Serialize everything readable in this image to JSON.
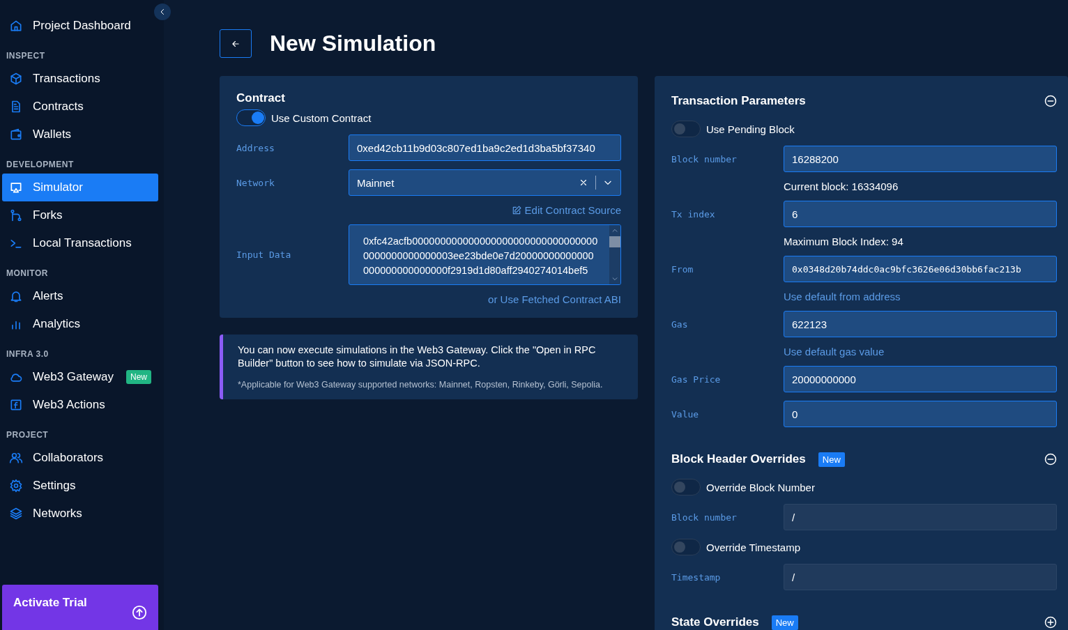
{
  "sidebar": {
    "top_item": {
      "label": "Project Dashboard",
      "selected": false
    },
    "sections": [
      {
        "title": "INSPECT",
        "items": [
          {
            "label": "Transactions",
            "selected": false
          },
          {
            "label": "Contracts",
            "selected": false
          },
          {
            "label": "Wallets",
            "selected": false
          }
        ]
      },
      {
        "title": "DEVELOPMENT",
        "items": [
          {
            "label": "Simulator",
            "selected": true
          },
          {
            "label": "Forks",
            "selected": false
          },
          {
            "label": "Local Transactions",
            "selected": false
          }
        ]
      },
      {
        "title": "MONITOR",
        "items": [
          {
            "label": "Alerts",
            "selected": false
          },
          {
            "label": "Analytics",
            "selected": false
          }
        ]
      },
      {
        "title": "INFRA 3.0",
        "items": [
          {
            "label": "Web3 Gateway",
            "selected": false,
            "badge": "New"
          },
          {
            "label": "Web3 Actions",
            "selected": false
          }
        ]
      },
      {
        "title": "PROJECT",
        "items": [
          {
            "label": "Collaborators",
            "selected": false
          },
          {
            "label": "Settings",
            "selected": false
          },
          {
            "label": "Networks",
            "selected": false
          }
        ]
      }
    ],
    "trial": {
      "title": "Activate Trial"
    }
  },
  "page_title": "New Simulation",
  "contract": {
    "title": "Contract",
    "toggle": {
      "label": "Use Custom Contract",
      "on": true
    },
    "rows": [
      {
        "kind": "input",
        "label": "Address",
        "value": "0xed42cb11b9d03c807ed1ba9c2ed1d3ba5bf37340"
      },
      {
        "kind": "select",
        "label": "Network",
        "value": "Mainnet"
      },
      {
        "kind": "link",
        "text": "Edit Contract Source"
      },
      {
        "kind": "textarea",
        "label": "Input Data",
        "lines": [
          "0xfc42acfb000000000000000000000000000000000",
          "0000000000000003ee23bde0e7d20000000000000",
          "000000000000000f2919d1d80aff2940274014bef5"
        ]
      },
      {
        "kind": "plainlink",
        "text": "or Use Fetched Contract ABI"
      }
    ]
  },
  "notice": {
    "text": "You can now execute simulations in the Web3 Gateway. Click the \"Open in RPC Builder\" button to see how to simulate via JSON-RPC.",
    "footnote": "*Applicable for Web3 Gateway supported networks: Mainnet, Ropsten, Rinkeby, Görli, Sepolia."
  },
  "parameters": [
    {
      "title": "Transaction Parameters",
      "expanded": true,
      "rows": [
        {
          "kind": "toggle",
          "label": "Use Pending Block",
          "on": false
        },
        {
          "kind": "field",
          "label": "Block number",
          "value": "16288200",
          "disabled": false
        },
        {
          "kind": "hint",
          "text": "Current block: 16334096"
        },
        {
          "kind": "field",
          "label": "Tx index",
          "value": "6",
          "disabled": false
        },
        {
          "kind": "hint",
          "text": "Maximum Block Index: 94"
        },
        {
          "kind": "field",
          "label": "From",
          "value": "0x0348d20b74ddc0ac9bfc3626e06d30bb6fac213b",
          "disabled": false,
          "mono": true
        },
        {
          "kind": "link",
          "text": "Use default from address"
        },
        {
          "kind": "field",
          "label": "Gas",
          "value": "622123",
          "disabled": false
        },
        {
          "kind": "link",
          "text": "Use default gas value"
        },
        {
          "kind": "field",
          "label": "Gas Price",
          "value": "20000000000",
          "disabled": false
        },
        {
          "kind": "field",
          "label": "Value",
          "value": "0",
          "disabled": false
        }
      ]
    },
    {
      "title": "Block Header Overrides",
      "badge": "New",
      "expanded": true,
      "rows": [
        {
          "kind": "toggle",
          "label": "Override Block Number",
          "on": false
        },
        {
          "kind": "field",
          "label": "Block number",
          "value": "/",
          "disabled": true
        },
        {
          "kind": "toggle",
          "label": "Override Timestamp",
          "on": false
        },
        {
          "kind": "field",
          "label": "Timestamp",
          "value": "/",
          "disabled": true
        }
      ]
    },
    {
      "title": "State Overrides",
      "badge": "New",
      "expanded": false
    }
  ]
}
